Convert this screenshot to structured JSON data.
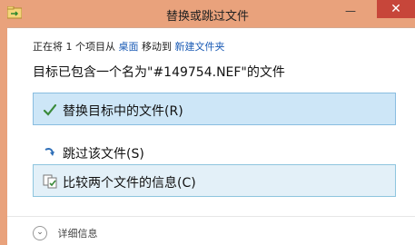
{
  "window": {
    "title": "替换或跳过文件",
    "minimize_glyph": "—",
    "close_glyph": "✕"
  },
  "info": {
    "prefix": "正在将 1 个项目从",
    "source": "桌面",
    "middle": "移动到",
    "target": "新建文件夹"
  },
  "headline": "目标已包含一个名为\"#149754.NEF\"的文件",
  "options": {
    "replace": "替换目标中的文件(R)",
    "skip": "跳过该文件(S)",
    "compare": "比较两个文件的信息(C)"
  },
  "details": {
    "label": "详细信息"
  },
  "colors": {
    "titlebar": "#e9a27c",
    "close": "#c7463a",
    "link": "#1a5bb5",
    "highlight": "#cde6f7"
  },
  "icons": {
    "app": "folder-move-icon",
    "replace": "checkmark-icon",
    "skip": "skip-arrow-icon",
    "compare": "compare-files-icon",
    "details": "chevron-down-icon"
  }
}
